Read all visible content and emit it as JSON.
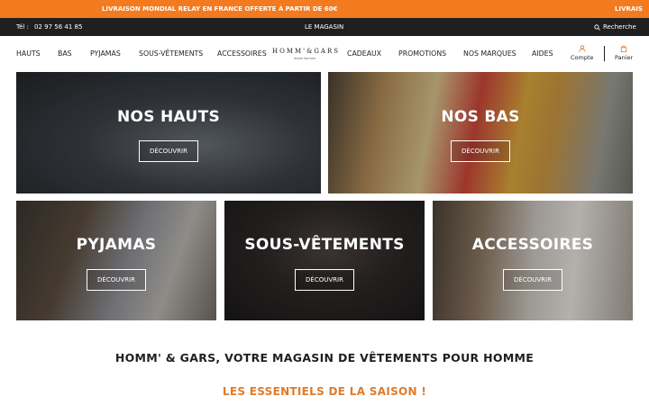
{
  "colors": {
    "promo_bar": "#f47a20",
    "top_bar": "#1f1f1f",
    "accent_orange": "#e07a2a"
  },
  "promo": {
    "message": "LIVRAISON MONDIAL RELAY EN FRANCE OFFERTE À PARTIR DE 60€",
    "message_repeat": "LIVRAIS"
  },
  "topbar": {
    "tel_label": "Tél :",
    "tel_number": "02 97 56 41 85",
    "store_link": "LE MAGASIN",
    "search_label": "Recherche",
    "search_icon": "search-icon"
  },
  "nav": {
    "items": [
      "HAUTS",
      "BAS",
      "PYJAMAS",
      "SOUS-VÊTEMENTS",
      "ACCESSOIRES",
      "CADEAUX",
      "PROMOTIONS",
      "NOS MARQUES",
      "AIDES"
    ],
    "logo_main": "HOMM'&GARS",
    "logo_sub": "mode homme",
    "account_label": "Compte",
    "account_icon": "user-icon",
    "cart_label": "Panier",
    "cart_icon": "bag-icon"
  },
  "tiles": [
    {
      "title": "NOS HAUTS",
      "button": "DÉCOUVRIR"
    },
    {
      "title": "NOS BAS",
      "button": "DÉCOUVRIR"
    },
    {
      "title": "PYJAMAS",
      "button": "DÉCOUVRIR"
    },
    {
      "title": "SOUS-VÊTEMENTS",
      "button": "DÉCOUVRIR"
    },
    {
      "title": "ACCESSOIRES",
      "button": "DÉCOUVRIR"
    }
  ],
  "content": {
    "headline": "HOMM' & GARS, VOTRE MAGASIN DE VÊTEMENTS POUR HOMME",
    "subline": "LES ESSENTIELS DE LA SAISON !"
  }
}
